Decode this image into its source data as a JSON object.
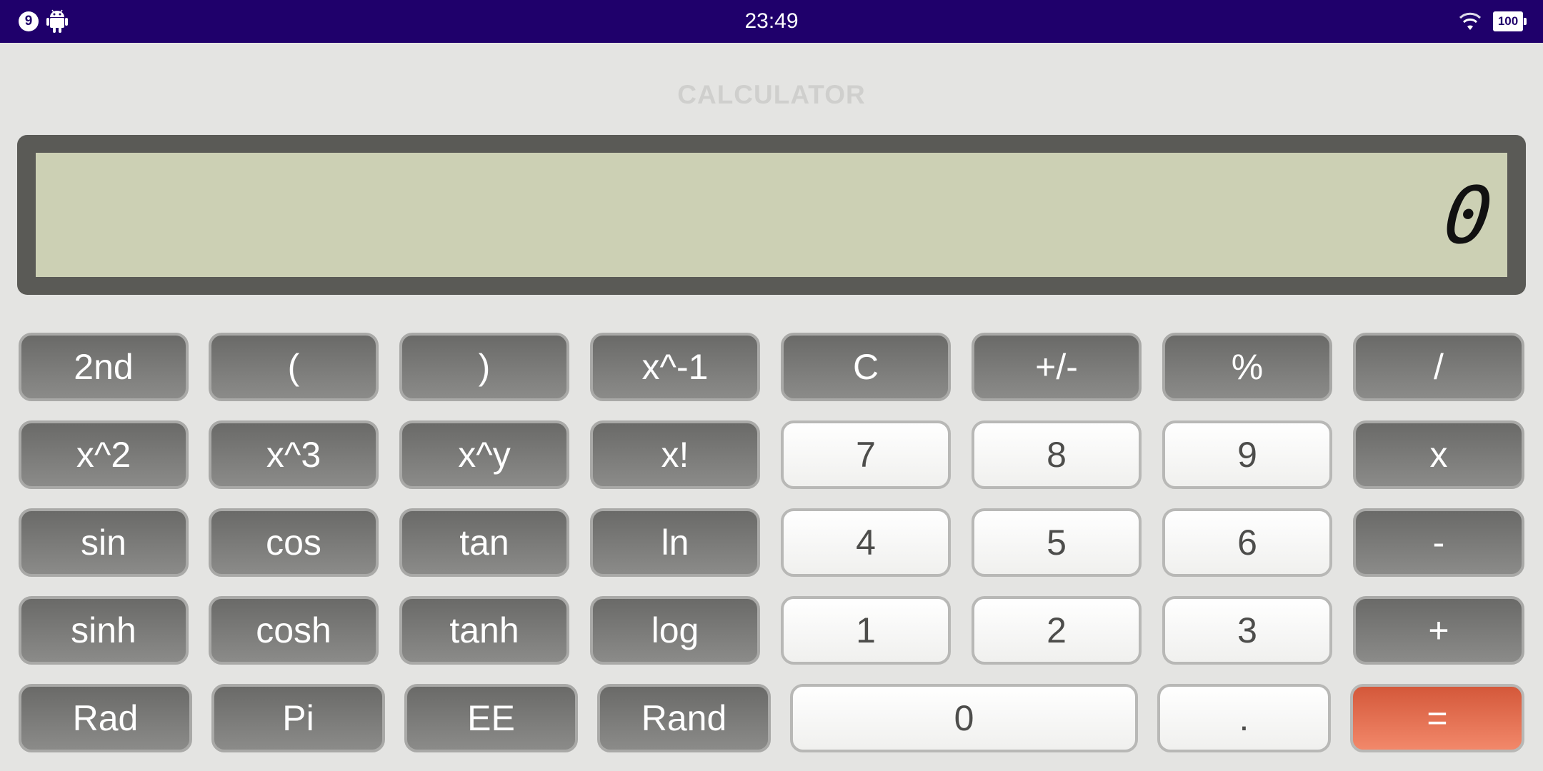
{
  "status_bar": {
    "notification_count": "9",
    "time": "23:49",
    "battery": "100"
  },
  "app": {
    "title": "CALCULATOR"
  },
  "display": {
    "value": "0"
  },
  "keys": {
    "second": "2nd",
    "lparen": "(",
    "rparen": ")",
    "reciprocal": "x^-1",
    "clear": "C",
    "negate": "+/-",
    "percent": "%",
    "divide": "/",
    "square": "x^2",
    "cube": "x^3",
    "power": "x^y",
    "factorial": "x!",
    "d7": "7",
    "d8": "8",
    "d9": "9",
    "multiply": "x",
    "sin": "sin",
    "cos": "cos",
    "tan": "tan",
    "ln": "ln",
    "d4": "4",
    "d5": "5",
    "d6": "6",
    "minus": "-",
    "sinh": "sinh",
    "cosh": "cosh",
    "tanh": "tanh",
    "log": "log",
    "d1": "1",
    "d2": "2",
    "d3": "3",
    "plus": "+",
    "rad": "Rad",
    "pi": "Pi",
    "ee": "EE",
    "rand": "Rand",
    "d0": "0",
    "dot": ".",
    "equals": "="
  },
  "colors": {
    "status_bar": "#1f006b",
    "background": "#e4e4e2",
    "display_frame": "#5a5a56",
    "display_screen": "#ccd0b4",
    "equals_key": "#e8704f"
  }
}
